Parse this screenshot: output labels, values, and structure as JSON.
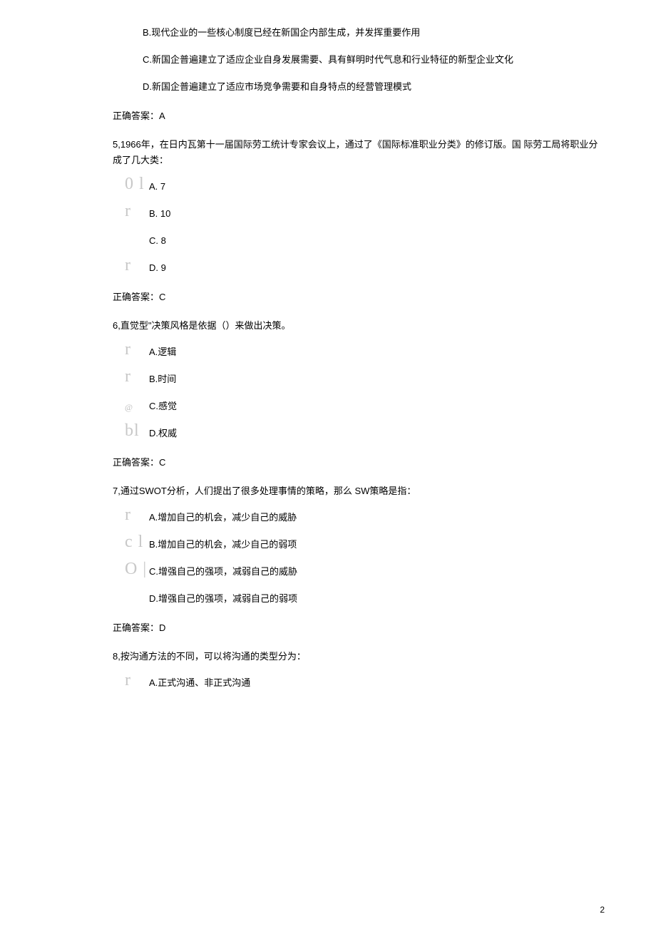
{
  "pageNumber": "2",
  "q4_continued": {
    "options": {
      "B": "B.现代企业的一些核心制度已经在新国企内部生成，并发挥重要作用",
      "C": "C.新国企普遍建立了适应企业自身发展需要、具有鲜明时代气息和行业特征的新型企业文化",
      "D": "D.新国企普遍建立了适应市场竞争需要和自身特点的经营管理模式"
    },
    "answer": "正确答案：A"
  },
  "q5": {
    "question": "5,1966年，在日内瓦第十一届国际劳工统计专家会议上，通过了《国际标准职业分类》的修订版。国 际劳工局将职业分成了几大类：",
    "options": {
      "A": "A.  7",
      "B": "B.  10",
      "C": "C. 8",
      "D": "D.  9"
    },
    "markers": {
      "A": "0 l",
      "B": "r",
      "C": "",
      "D": "r"
    },
    "answer": "正确答案：C"
  },
  "q6": {
    "question": "6,直觉型\"决策风格是依据（）来做出决策。",
    "options": {
      "A": "A.逻辑",
      "B": "B.时间",
      "C": "C.感觉",
      "D": "D.权威"
    },
    "markers": {
      "A": "r",
      "B": "r",
      "C": "@",
      "D": "bl"
    },
    "answer": "正确答案：C"
  },
  "q7": {
    "question": "7,通过SWOT分析，人们提出了很多处理事情的策略，那么 SW策略是指：",
    "options": {
      "A": "A.增加自己的机会，减少自己的威胁",
      "B": "B.增加自己的机会，减少自己的弱项",
      "C": "C.增强自己的强项，减弱自己的威胁",
      "D": "D.增强自己的强项，减弱自己的弱项"
    },
    "markers": {
      "A": "r",
      "B": "c l",
      "C": "O |",
      "D": ""
    },
    "answer": "正确答案：D"
  },
  "q8": {
    "question": "8,按沟通方法的不同，可以将沟通的类型分为：",
    "options": {
      "A": "A.正式沟通、非正式沟通"
    },
    "markers": {
      "A": "r"
    }
  }
}
